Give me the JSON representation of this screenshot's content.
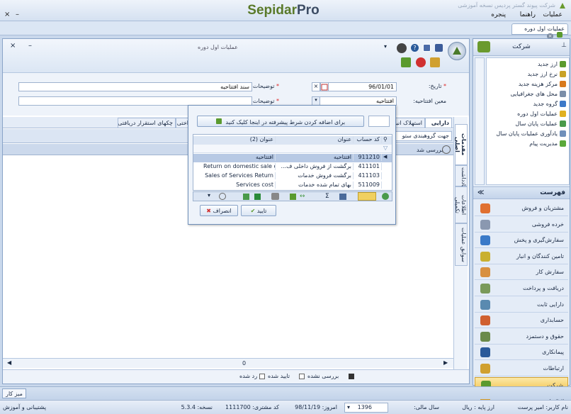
{
  "app": {
    "title": "شرکت پیوند گستر پردیس نسخه آموزشی",
    "brand_main": "Sepidar",
    "brand_suffix": "Pro",
    "menu": [
      "عملیات",
      "راهنما",
      "پنجره"
    ],
    "window_buttons": [
      "×",
      "–"
    ],
    "doc_tab": "عملیات اول دوره"
  },
  "docwin": {
    "title": "عملیات اول دوره",
    "controls": [
      "×",
      "–"
    ],
    "form": {
      "date_label": "تاریخ:",
      "date_value": "96/01/01",
      "desc_label": "توضیحات:",
      "desc_value": "سند افتتاحیه",
      "opening_label": "معین افتتاحیه:",
      "opening_value": "افتتاحیه",
      "desc2_label": "توضیحات (2):",
      "desc2_value": ""
    },
    "tabs": [
      "دارایی",
      "استهلاک انبا",
      "چکهای استقرار دریافتی",
      "اختی"
    ],
    "group_hint": "جهت گروهبندی ستو",
    "grid_headers": [
      "بررسی شد"
    ],
    "side_tabs": [
      "مقدمات اصلی",
      "یادداشت",
      "اطلاعات تکمیلی",
      "سوابق عملیات"
    ],
    "footer_value": "0",
    "status_filters": [
      "بررسی نشده",
      "تایید شده",
      "رد شده"
    ]
  },
  "popup": {
    "filter_button": "برای اضافه کردن شرط پیشرفته در اینجا کلیک کنید",
    "columns": [
      "کد حساب",
      "عنوان",
      "عنوان (2)"
    ],
    "rows": [
      {
        "code": "911210",
        "title": "افتتاحیه",
        "title2": "افتتاحیه"
      },
      {
        "code": "411101",
        "title": "برگشت از فروش داخلی ف...",
        "title2": "Return on domestic sale o..."
      },
      {
        "code": "411103",
        "title": "برگشت فروش خدمات",
        "title2": "Sales of Services Return"
      },
      {
        "code": "511009",
        "title": "بهای تمام شده خدمات",
        "title2": "Services cost"
      }
    ],
    "ok": "تایید",
    "cancel": "انصراف"
  },
  "rpanel": {
    "title": "شرکت",
    "tree": [
      {
        "label": "ارز جدید",
        "color": "#5b9a2e"
      },
      {
        "label": "نرخ ارز جدید",
        "color": "#c9a227"
      },
      {
        "label": "مرکز هزینه جدید",
        "color": "#d87a1e"
      },
      {
        "label": "محل های جغرافیایی",
        "color": "#7b8ea8"
      },
      {
        "label": "گروه جدید",
        "color": "#3c78c8"
      },
      {
        "label": "عملیات اول دوره",
        "color": "#e0b020"
      },
      {
        "label": "عملیات پایان سال",
        "color": "#4a9a4a"
      },
      {
        "label": "یادآوری عملیات پایان سال",
        "color": "#6f8fba"
      },
      {
        "label": "مدیریت پیام",
        "color": "#5aa83a"
      }
    ],
    "index_label": "فهرست",
    "nav": [
      {
        "label": "مشتریان و فروش",
        "color": "#e07030"
      },
      {
        "label": "خرده فروشی",
        "color": "#8a98b0"
      },
      {
        "label": "سفارش‌گیری و پخش",
        "color": "#3a7ac8"
      },
      {
        "label": "تامین کنندگان و انبار",
        "color": "#c9b030"
      },
      {
        "label": "سفارش کار",
        "color": "#d89040"
      },
      {
        "label": "دریافت و پرداخت",
        "color": "#7a9a5a"
      },
      {
        "label": "دارایی ثابت",
        "color": "#5a8ab0"
      },
      {
        "label": "حسابداری",
        "color": "#d06030"
      },
      {
        "label": "حقوق و دستمزد",
        "color": "#6a8a4a"
      },
      {
        "label": "پیمانکاری",
        "color": "#2a5a9a"
      },
      {
        "label": "ارتباطات",
        "color": "#d0a030"
      },
      {
        "label": "شرکت",
        "color": "#5a9a2e",
        "active": true
      },
      {
        "label": "تنظیمات",
        "color": "#e0a020"
      }
    ]
  },
  "bottom": {
    "desk": "میز کار"
  },
  "statusbar": {
    "user": "نام کاربر: امیر پرست",
    "currency": "ارز پایه : ریال",
    "fiscal_label": "سال مالی:",
    "fiscal_value": "1396",
    "today": "امروز: 98/11/19",
    "customer_code": "کد مشتری: 1111700",
    "version": "نسخه: 5.3.4",
    "support": "پشتیبانی و آموزش"
  }
}
